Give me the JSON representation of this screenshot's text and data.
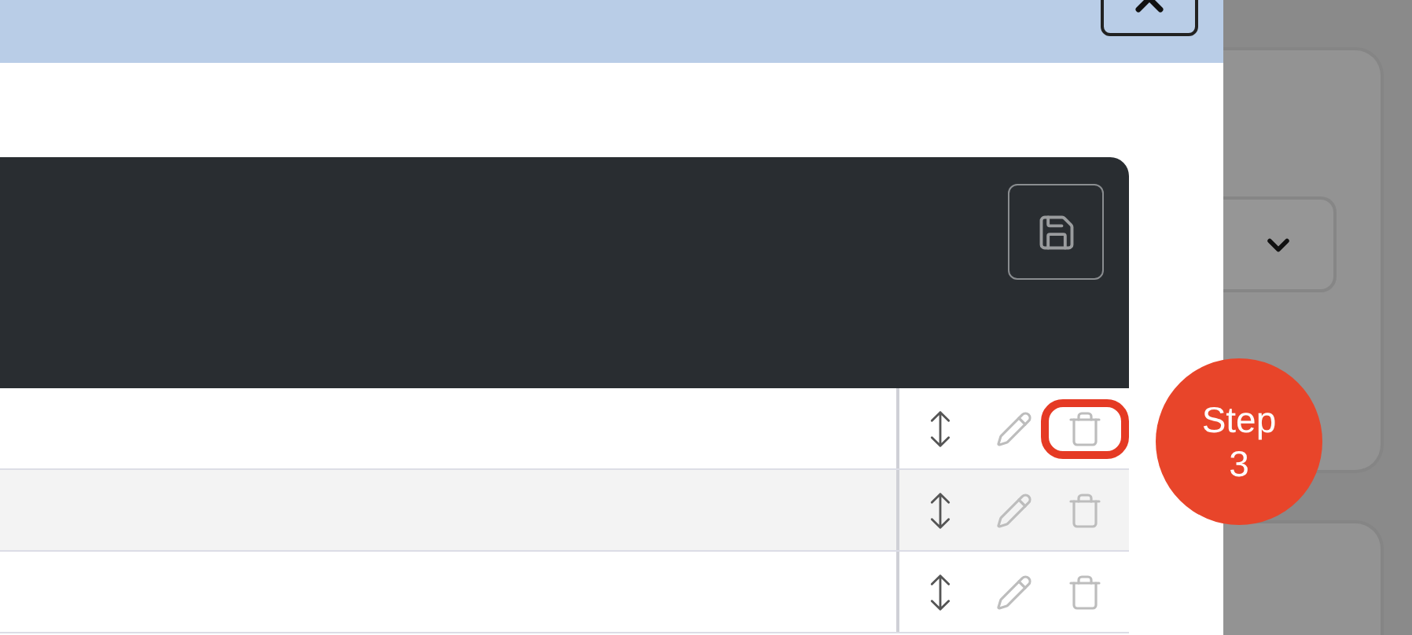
{
  "rows": [
    {
      "highlighted": true
    },
    {
      "highlighted": false
    },
    {
      "highlighted": false
    }
  ],
  "step_badge": {
    "label": "Step",
    "number": "3"
  }
}
